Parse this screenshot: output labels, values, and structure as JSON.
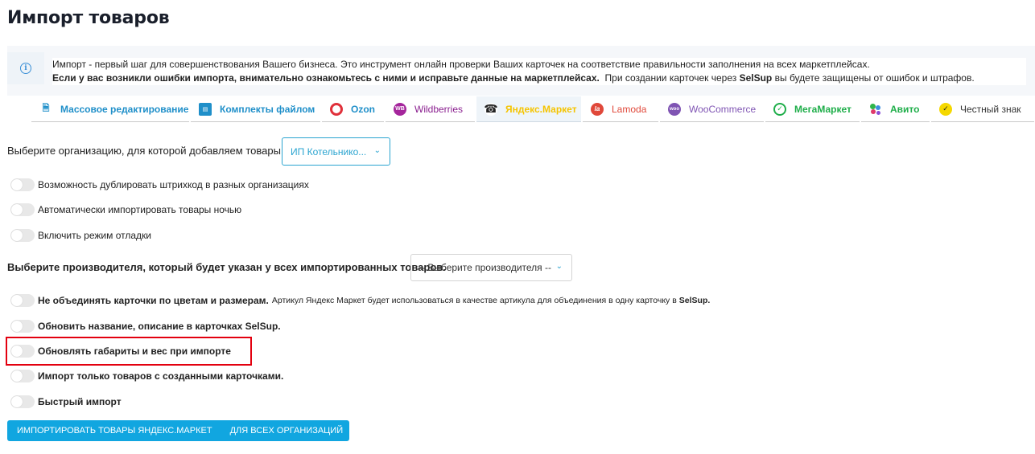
{
  "page": {
    "title": "Импорт товаров"
  },
  "info": {
    "line1": "Импорт - первый шаг для совершенствования Вашего бизнеса. Это инструмент онлайн проверки Ваших карточек на соответствие правильности заполнения на всех маркетплейсах.",
    "line2_bold": "Если у вас возникли ошибки импорта, внимательно ознакомьтесь с ними и исправьте данные на маркетплейсах.",
    "line2_pre": "При создании карточек через",
    "line2_brand": "SelSup",
    "line2_post": "вы будете защищены от ошибок и штрафов."
  },
  "tabs": [
    {
      "label": "Массовое редактирование",
      "color": "#1f8fc9",
      "icon": "file-icon"
    },
    {
      "label": "Комплекты файлом",
      "color": "#1f8fc9",
      "icon": "kit-icon"
    },
    {
      "label": "Ozon",
      "color": "#1f8fc9",
      "icon": "ozon-logo-icon"
    },
    {
      "label": "Wildberries",
      "color": "#8a1f8f",
      "icon": "wildberries-logo-icon",
      "badge": "WB"
    },
    {
      "label": "Яндекс.Маркет",
      "color": "#f5c400",
      "icon": "yandex-market-logo-icon"
    },
    {
      "label": "Lamoda",
      "color": "#e0483a",
      "icon": "lamoda-logo-icon",
      "badge": "la"
    },
    {
      "label": "WooCommerce",
      "color": "#7f54b3",
      "icon": "woocommerce-logo-icon",
      "badge": "woo"
    },
    {
      "label": "МегаМаркет",
      "color": "#1fae4a",
      "icon": "megamarket-logo-icon"
    },
    {
      "label": "Авито",
      "color": "#1fae4a",
      "icon": "avito-logo-icon"
    },
    {
      "label": "Честный знак",
      "color": "#333333",
      "icon": "chestny-znak-logo-icon"
    }
  ],
  "org": {
    "label": "Выберите организацию, для которой добавляем товары",
    "selected": "ИП Котельнико..."
  },
  "toggles_top": [
    {
      "label": "Возможность дублировать штрихкод в разных организациях"
    },
    {
      "label": "Автоматически импортировать товары ночью"
    },
    {
      "label": "Включить режим отладки"
    }
  ],
  "manufacturer": {
    "label": "Выберите производителя, который будет указан у всех импортированных товаров.",
    "selected": "-- Выберите производителя --"
  },
  "toggles_bottom": {
    "merge_bold": "Не объединять карточки по цветам и размерам.",
    "merge_note": "Артикул Яндекс Маркет будет использоваться в качестве артикула для объединения в одну карточку в",
    "merge_note_brand": "SelSup.",
    "update_name": "Обновить название, описание в карточках SelSup.",
    "update_dims": "Обновлять габариты и вес при импорте",
    "only_created": "Импорт только товаров с созданными карточками.",
    "fast_import": "Быстрый импорт"
  },
  "button": {
    "part1": "ИМПОРТИРОВАТЬ ТОВАРЫ ЯНДЕКС.МАРКЕТ",
    "part2": "ДЛЯ ВСЕХ ОРГАНИЗАЦИЙ"
  },
  "colors": {
    "accent": "#11a6e0",
    "highlight": "#e3000f"
  }
}
